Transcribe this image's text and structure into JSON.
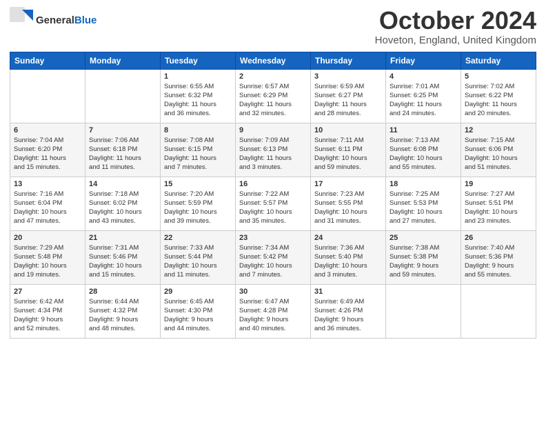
{
  "header": {
    "logo_general": "General",
    "logo_blue": "Blue",
    "month": "October 2024",
    "location": "Hoveton, England, United Kingdom"
  },
  "weekdays": [
    "Sunday",
    "Monday",
    "Tuesday",
    "Wednesday",
    "Thursday",
    "Friday",
    "Saturday"
  ],
  "weeks": [
    [
      {
        "num": "",
        "info": ""
      },
      {
        "num": "",
        "info": ""
      },
      {
        "num": "1",
        "info": "Sunrise: 6:55 AM\nSunset: 6:32 PM\nDaylight: 11 hours\nand 36 minutes."
      },
      {
        "num": "2",
        "info": "Sunrise: 6:57 AM\nSunset: 6:29 PM\nDaylight: 11 hours\nand 32 minutes."
      },
      {
        "num": "3",
        "info": "Sunrise: 6:59 AM\nSunset: 6:27 PM\nDaylight: 11 hours\nand 28 minutes."
      },
      {
        "num": "4",
        "info": "Sunrise: 7:01 AM\nSunset: 6:25 PM\nDaylight: 11 hours\nand 24 minutes."
      },
      {
        "num": "5",
        "info": "Sunrise: 7:02 AM\nSunset: 6:22 PM\nDaylight: 11 hours\nand 20 minutes."
      }
    ],
    [
      {
        "num": "6",
        "info": "Sunrise: 7:04 AM\nSunset: 6:20 PM\nDaylight: 11 hours\nand 15 minutes."
      },
      {
        "num": "7",
        "info": "Sunrise: 7:06 AM\nSunset: 6:18 PM\nDaylight: 11 hours\nand 11 minutes."
      },
      {
        "num": "8",
        "info": "Sunrise: 7:08 AM\nSunset: 6:15 PM\nDaylight: 11 hours\nand 7 minutes."
      },
      {
        "num": "9",
        "info": "Sunrise: 7:09 AM\nSunset: 6:13 PM\nDaylight: 11 hours\nand 3 minutes."
      },
      {
        "num": "10",
        "info": "Sunrise: 7:11 AM\nSunset: 6:11 PM\nDaylight: 10 hours\nand 59 minutes."
      },
      {
        "num": "11",
        "info": "Sunrise: 7:13 AM\nSunset: 6:08 PM\nDaylight: 10 hours\nand 55 minutes."
      },
      {
        "num": "12",
        "info": "Sunrise: 7:15 AM\nSunset: 6:06 PM\nDaylight: 10 hours\nand 51 minutes."
      }
    ],
    [
      {
        "num": "13",
        "info": "Sunrise: 7:16 AM\nSunset: 6:04 PM\nDaylight: 10 hours\nand 47 minutes."
      },
      {
        "num": "14",
        "info": "Sunrise: 7:18 AM\nSunset: 6:02 PM\nDaylight: 10 hours\nand 43 minutes."
      },
      {
        "num": "15",
        "info": "Sunrise: 7:20 AM\nSunset: 5:59 PM\nDaylight: 10 hours\nand 39 minutes."
      },
      {
        "num": "16",
        "info": "Sunrise: 7:22 AM\nSunset: 5:57 PM\nDaylight: 10 hours\nand 35 minutes."
      },
      {
        "num": "17",
        "info": "Sunrise: 7:23 AM\nSunset: 5:55 PM\nDaylight: 10 hours\nand 31 minutes."
      },
      {
        "num": "18",
        "info": "Sunrise: 7:25 AM\nSunset: 5:53 PM\nDaylight: 10 hours\nand 27 minutes."
      },
      {
        "num": "19",
        "info": "Sunrise: 7:27 AM\nSunset: 5:51 PM\nDaylight: 10 hours\nand 23 minutes."
      }
    ],
    [
      {
        "num": "20",
        "info": "Sunrise: 7:29 AM\nSunset: 5:48 PM\nDaylight: 10 hours\nand 19 minutes."
      },
      {
        "num": "21",
        "info": "Sunrise: 7:31 AM\nSunset: 5:46 PM\nDaylight: 10 hours\nand 15 minutes."
      },
      {
        "num": "22",
        "info": "Sunrise: 7:33 AM\nSunset: 5:44 PM\nDaylight: 10 hours\nand 11 minutes."
      },
      {
        "num": "23",
        "info": "Sunrise: 7:34 AM\nSunset: 5:42 PM\nDaylight: 10 hours\nand 7 minutes."
      },
      {
        "num": "24",
        "info": "Sunrise: 7:36 AM\nSunset: 5:40 PM\nDaylight: 10 hours\nand 3 minutes."
      },
      {
        "num": "25",
        "info": "Sunrise: 7:38 AM\nSunset: 5:38 PM\nDaylight: 9 hours\nand 59 minutes."
      },
      {
        "num": "26",
        "info": "Sunrise: 7:40 AM\nSunset: 5:36 PM\nDaylight: 9 hours\nand 55 minutes."
      }
    ],
    [
      {
        "num": "27",
        "info": "Sunrise: 6:42 AM\nSunset: 4:34 PM\nDaylight: 9 hours\nand 52 minutes."
      },
      {
        "num": "28",
        "info": "Sunrise: 6:44 AM\nSunset: 4:32 PM\nDaylight: 9 hours\nand 48 minutes."
      },
      {
        "num": "29",
        "info": "Sunrise: 6:45 AM\nSunset: 4:30 PM\nDaylight: 9 hours\nand 44 minutes."
      },
      {
        "num": "30",
        "info": "Sunrise: 6:47 AM\nSunset: 4:28 PM\nDaylight: 9 hours\nand 40 minutes."
      },
      {
        "num": "31",
        "info": "Sunrise: 6:49 AM\nSunset: 4:26 PM\nDaylight: 9 hours\nand 36 minutes."
      },
      {
        "num": "",
        "info": ""
      },
      {
        "num": "",
        "info": ""
      }
    ]
  ]
}
